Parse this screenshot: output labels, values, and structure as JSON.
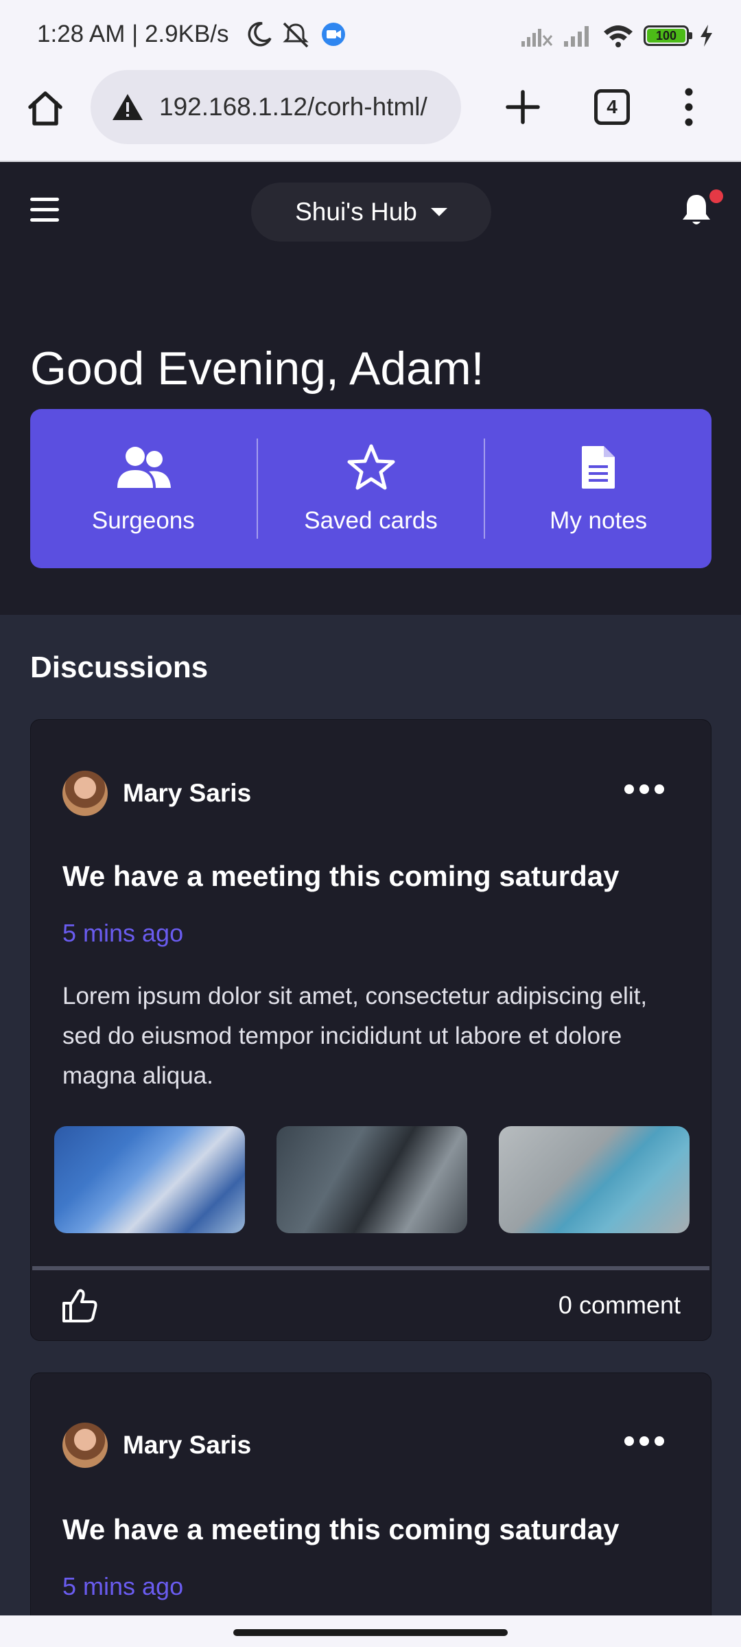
{
  "status_bar": {
    "time_and_speed": "1:28 AM | 2.9KB/s",
    "battery_level": "100",
    "icons": [
      "moon-icon",
      "vibrate-off-icon",
      "video-app-icon",
      "signal-off-icon",
      "signal-icon",
      "wifi-icon",
      "battery-icon",
      "charging-icon"
    ]
  },
  "browser": {
    "url": "192.168.1.12/corh-html/",
    "tab_count": "4",
    "security_icon": "warning-icon"
  },
  "header": {
    "hub_name": "Shui's Hub",
    "has_notification": true
  },
  "greeting": "Good Evening, Adam!",
  "quick_actions": [
    {
      "label": "Surgeons",
      "icon": "users-icon"
    },
    {
      "label": "Saved cards",
      "icon": "star-icon"
    },
    {
      "label": "My notes",
      "icon": "file-text-icon"
    }
  ],
  "discussions": {
    "title": "Discussions",
    "posts": [
      {
        "author": "Mary Saris",
        "title": "We have a meeting this coming saturday",
        "time": "5 mins ago",
        "body": "Lorem ipsum dolor sit amet, consectetur adipiscing elit, sed do eiusmod tempor incididunt ut labore et dolore magna aliqua.",
        "images": [
          "surgeon-image",
          "surgical-tools-image",
          "gloves-image"
        ],
        "comments": "0 comment"
      },
      {
        "author": "Mary Saris",
        "title": "We have a meeting this coming saturday",
        "time": "5 mins ago"
      }
    ]
  },
  "colors": {
    "accent": "#5b4fe0",
    "dark_bg": "#1d1d28",
    "content_bg": "#272a39",
    "time_text": "#6a5cf0",
    "notification_dot": "#e53945"
  }
}
